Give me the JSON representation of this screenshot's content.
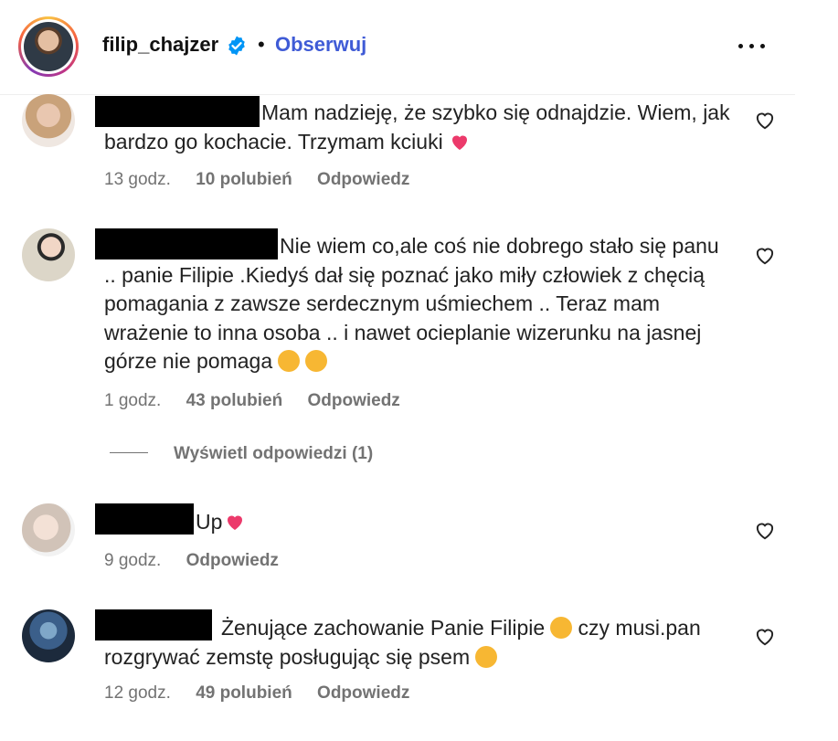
{
  "header": {
    "username": "filip_chajzer",
    "separator": "•",
    "follow_label": "Obserwuj",
    "verified_color": "#0095f6"
  },
  "comments": [
    {
      "text": "Mam nadzieję, że szybko się odnajdzie. Wiem, jak bardzo go kochacie. Trzymam kciuki",
      "emoji": "pink-heart",
      "time": "13 godz.",
      "likes": "10 polubień",
      "reply_label": "Odpowiedz"
    },
    {
      "text": "Nie wiem co,ale coś nie dobrego stało się panu .. panie Filipie .Kiedyś dał się poznać jako miły człowiek z chęcią pomagania z zawsze serdecznym uśmiechem .. Teraz mam wrażenie to inna osoba .. i nawet ocieplanie wizerunku na jasnej górze nie pomaga",
      "emoji": "woozy-face x2",
      "time": "1 godz.",
      "likes": "43 polubień",
      "reply_label": "Odpowiedz",
      "view_replies": "Wyświetl odpowiedzi (1)"
    },
    {
      "text": "Up",
      "emoji": "pink-heart",
      "time": "9 godz.",
      "reply_label": "Odpowiedz"
    },
    {
      "text_part1": "Żenujące zachowanie Panie Filipie",
      "text_part2": "czy musi.pan rozgrywać zemstę posługując się psem",
      "emoji": "kissing-heart-face, loudly-crying-face",
      "time": "12 godz.",
      "likes": "49 polubień",
      "reply_label": "Odpowiedz"
    }
  ]
}
